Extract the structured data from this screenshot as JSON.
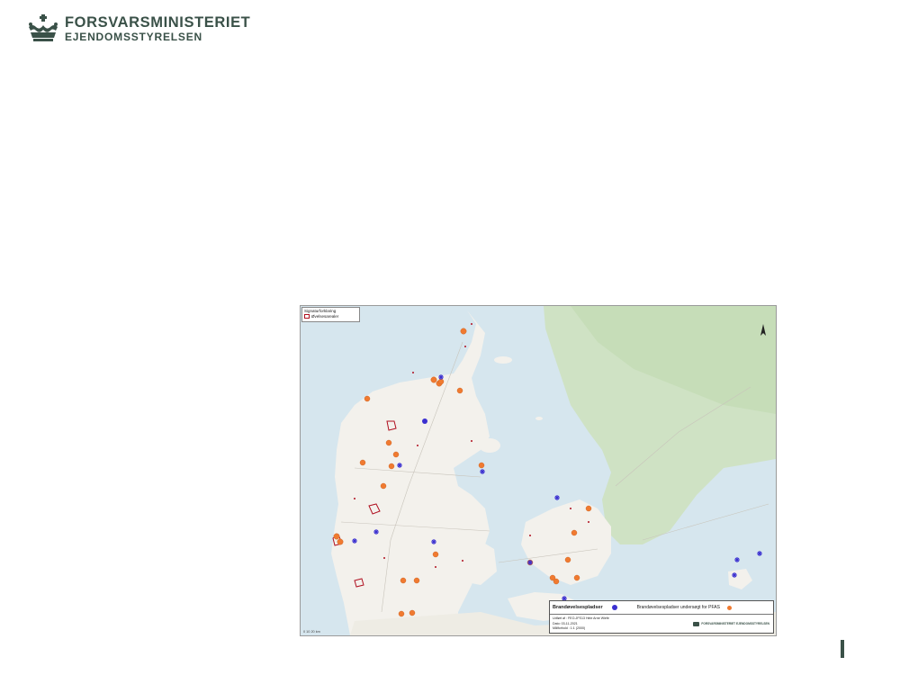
{
  "header": {
    "org_line1": "FORSVARSMINISTERIET",
    "org_line2": "EJENDOMSSTYRELSEN",
    "crown_icon": "royal-crown-icon",
    "brand_color": "#3a5148"
  },
  "map": {
    "legend": {
      "title": "Signaturforklaring",
      "item": "Øvelsesarealer",
      "item_color": "#b01020"
    },
    "scale_note": "0 10 20 km",
    "info_box": {
      "title": "Brandøvelsespladser",
      "pfas_label": "Brandøvelsespladser undersøgt for PFAS",
      "blue_marker_color": "#3a2fd0",
      "orange_marker_color": "#f07a30",
      "made_by": "Udført af : FEO-JFS13 Hele Arne Wiefe",
      "date": "Dato: 03-11-2021",
      "scale": "Målforhold : 1:1 (2000)",
      "mini_logo": "FORSVARSMINISTERIET EJENDOMSSTYRELSEN"
    }
  }
}
